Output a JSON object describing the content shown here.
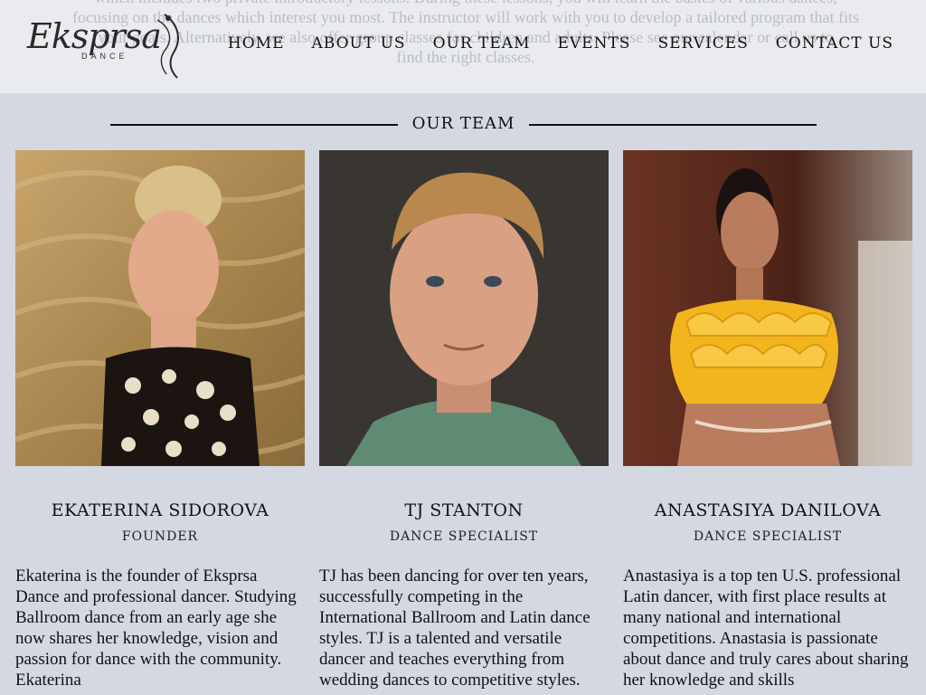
{
  "intro": {
    "lines": [
      "which includes two private introductory lessons. During these lessons, you will learn the basics of various dances,",
      "focusing on the dances which interest you most. The instructor will work with you to develop a tailored program that fits",
      "your goals. Alternatively, we also offer group classes for children and adults. Please see our calendar or call us to",
      "find the right classes."
    ]
  },
  "brand": {
    "name": "Eksprsa",
    "sub": "DANCE"
  },
  "nav": {
    "items": [
      "HOME",
      "ABOUT US",
      "OUR TEAM",
      "EVENTS",
      "SERVICES",
      "CONTACT US"
    ]
  },
  "team": {
    "heading": "OUR TEAM",
    "members": [
      {
        "name": "EKATERINA SIDOROVA",
        "role": "FOUNDER",
        "bio": "Ekaterina is the founder of Eksprsa Dance and professional dancer. Studying Ballroom dance from an early age she now shares her knowledge, vision and passion for dance with the community. Ekaterina",
        "photo_colors": {
          "bg": "#b8935a",
          "accent": "#1c1410"
        }
      },
      {
        "name": "TJ STANTON",
        "role": "DANCE SPECIALIST",
        "bio": "TJ has been dancing for over ten years, successfully competing in the International Ballroom and Latin dance styles. TJ is a talented and versatile dancer and teaches everything from wedding dances to competitive styles.",
        "photo_colors": {
          "bg": "#3d3a36",
          "accent": "#5f8a74"
        }
      },
      {
        "name": "ANASTASIYA DANILOVA",
        "role": "DANCE SPECIALIST",
        "bio": "Anastasiya is a top ten U.S. professional Latin dancer, with first place results at many national and international competitions. Anastasia is passionate about dance and truly cares about sharing her knowledge and skills",
        "photo_colors": {
          "bg": "#5a2a20",
          "accent": "#f2b51e"
        }
      }
    ]
  }
}
